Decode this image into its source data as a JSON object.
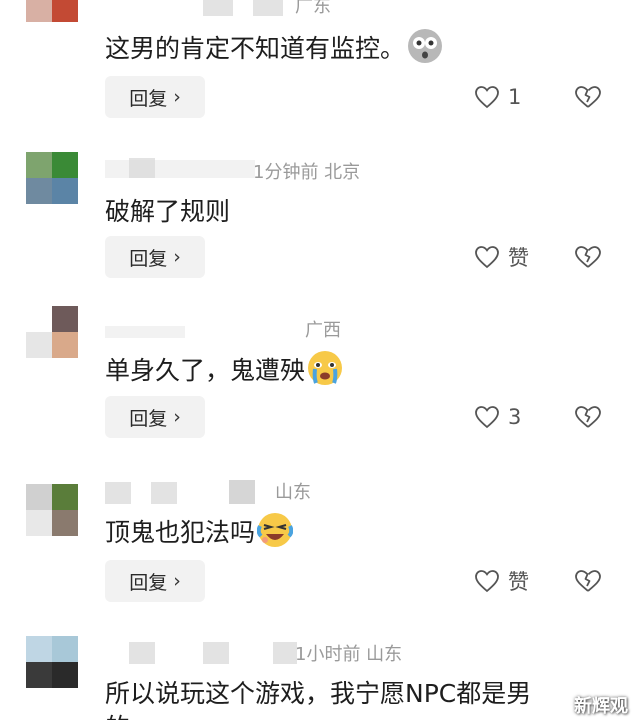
{
  "comments": [
    {
      "meta": "广东",
      "content": "这男的肯定不知道有监控。",
      "emoji": "shocked-face-emoji",
      "reply_label": "回复",
      "like_count": "1"
    },
    {
      "meta": "1分钟前  北京",
      "content": "破解了规则",
      "reply_label": "回复",
      "like_count": "赞"
    },
    {
      "meta": "广西",
      "content": "单身久了，鬼遭殃",
      "emoji": "crying-face-emoji",
      "reply_label": "回复",
      "like_count": "3"
    },
    {
      "meta": "山东",
      "content": "顶鬼也犯法吗",
      "emoji": "laughing-crying-emoji",
      "reply_label": "回复",
      "like_count": "赞"
    },
    {
      "meta": "1小时前  山东",
      "content": "所以说玩这个游戏，我宁愿NPC都是男",
      "content_cut": "的"
    }
  ],
  "watermark": "新辉观",
  "colors": {
    "text": "#1e1e1e",
    "meta": "#9a9a9a",
    "button_bg": "#f2f2f2"
  }
}
